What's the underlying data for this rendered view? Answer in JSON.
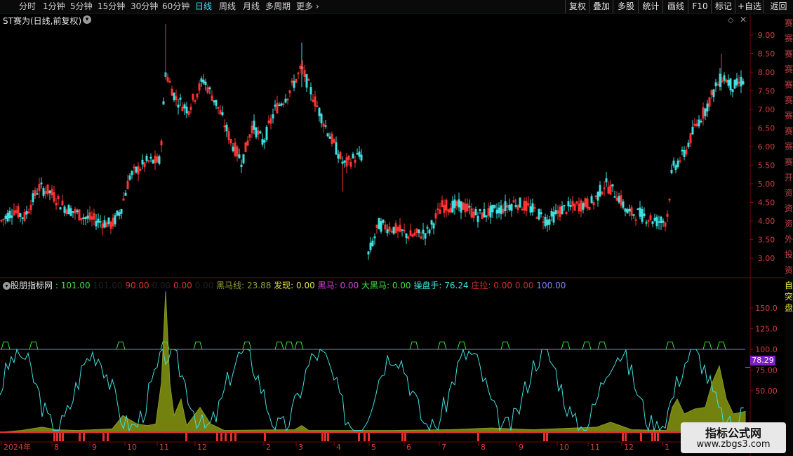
{
  "toolbar": {
    "periods": [
      "分时",
      "1分钟",
      "5分钟",
      "15分钟",
      "30分钟",
      "60分钟",
      "日线",
      "周线",
      "月线",
      "多周期",
      "更多"
    ],
    "active_period": "日线",
    "more_icon": "chevron-right-icon",
    "right_buttons": [
      "复权",
      "叠加",
      "多股",
      "统计",
      "画线",
      "F10",
      "标记",
      "+自选",
      "返回"
    ]
  },
  "main_chart": {
    "title": "ST赛为(日线,前复权)",
    "price_axis": [
      "9.00",
      "8.50",
      "8.00",
      "7.50",
      "7.00",
      "6.50",
      "6.00",
      "5.50",
      "5.00",
      "4.50",
      "4.00",
      "3.50",
      "3.00"
    ]
  },
  "indicator": {
    "name": "股朋指标网",
    "items": [
      {
        "text": ": 101.00",
        "color": "#40e040"
      },
      {
        "text": " 101.00 ",
        "color": "#202020"
      },
      {
        "text": " 90.00",
        "color": "#e03030"
      },
      {
        "text": "  0.00 ",
        "color": "#202020"
      },
      {
        "text": " 0.00 ",
        "color": "#e03030"
      },
      {
        "text": " 0.00 ",
        "color": "#202020"
      },
      {
        "text": "黑马线: 23.88",
        "color": "#90a030"
      },
      {
        "text": " 发现: 0.00",
        "color": "#e0e040"
      },
      {
        "text": " 黑马: 0.00",
        "color": "#e040e0"
      },
      {
        "text": " 大黑马: 0.00",
        "color": "#40e040"
      },
      {
        "text": " 操盘手: 76.24",
        "color": "#40e0e0"
      },
      {
        "text": " 庄拉: 0.00",
        "color": "#e03030"
      },
      {
        "text": "  0.00",
        "color": "#c03030"
      },
      {
        "text": " 100.00",
        "color": "#8080ff"
      }
    ],
    "axis": [
      "150.0",
      "125.0",
      "100.0",
      "75.00",
      "50.00"
    ],
    "current_value": "78.29"
  },
  "date_axis": [
    "2024年",
    "8",
    "9",
    "10",
    "11",
    "12",
    "2",
    "3",
    "4",
    "5",
    "6",
    "7",
    "8",
    "9",
    "10",
    "11",
    "12",
    "1"
  ],
  "sidebar_chars": [
    "赛",
    "赛",
    "赛",
    "赛",
    "赛",
    "赛",
    "赛",
    "赛",
    "赛",
    "赛",
    "开",
    "资",
    "资",
    "资",
    "外",
    "投",
    "资"
  ],
  "sidebar_chars2": [
    "自",
    "突",
    "盘"
  ],
  "watermark": {
    "title": "指标公式网",
    "url": "www.zbgs3.com"
  },
  "colors": {
    "up": "#ff3333",
    "down": "#40e0e0",
    "background": "#000000",
    "axis": "#7a0000"
  }
}
